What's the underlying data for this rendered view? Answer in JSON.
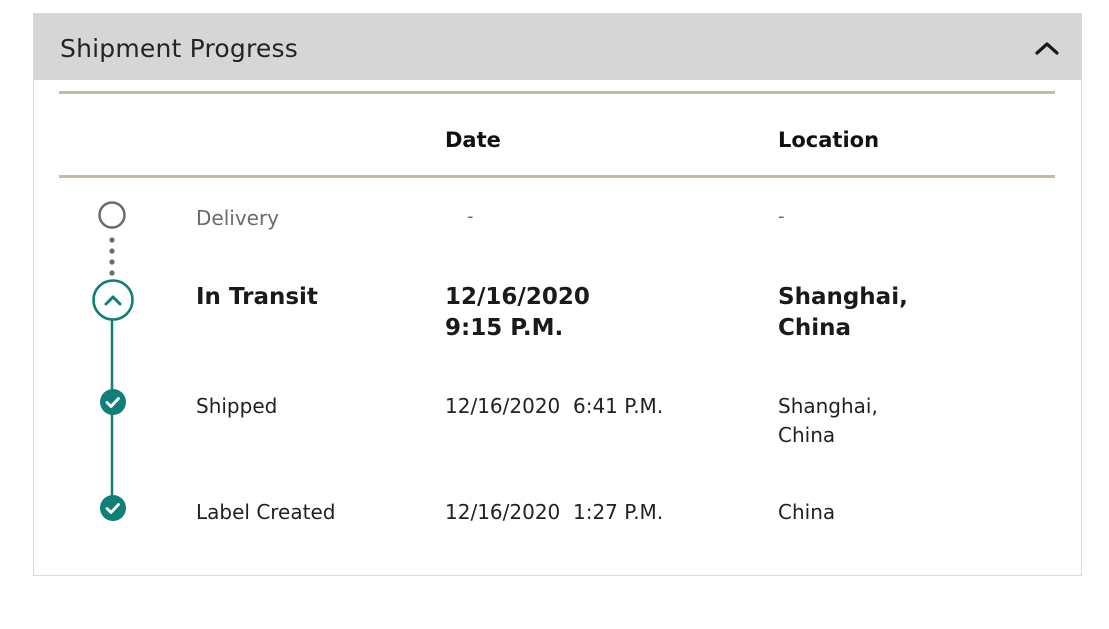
{
  "panel": {
    "title": "Shipment Progress",
    "collapse_icon": "chevron-up-icon"
  },
  "table": {
    "headers": {
      "status": "",
      "date": "Date",
      "location": "Location"
    },
    "rows": [
      {
        "status": "Delivery",
        "date": "-",
        "location": "-",
        "state": "pending",
        "icon": "empty-circle-icon"
      },
      {
        "status": "In Transit",
        "date_line1": "12/16/2020",
        "date_line2": "9:15 P.M.",
        "location_line1": "Shanghai,",
        "location_line2": "China",
        "state": "current",
        "icon": "chevron-up-circle-icon"
      },
      {
        "status": "Shipped",
        "date": "12/16/2020  6:41 P.M.",
        "location_line1": "Shanghai,",
        "location_line2": "China",
        "state": "complete",
        "icon": "check-circle-icon"
      },
      {
        "status": "Label Created",
        "date": "12/16/2020  1:27 P.M.",
        "location": "China",
        "state": "complete",
        "icon": "check-circle-icon"
      }
    ]
  },
  "colors": {
    "header_bg": "#d6d6d6",
    "accent_teal": "#0f7f77",
    "pending_gray": "#6b6b6b",
    "rule": "#c5b9a8"
  }
}
